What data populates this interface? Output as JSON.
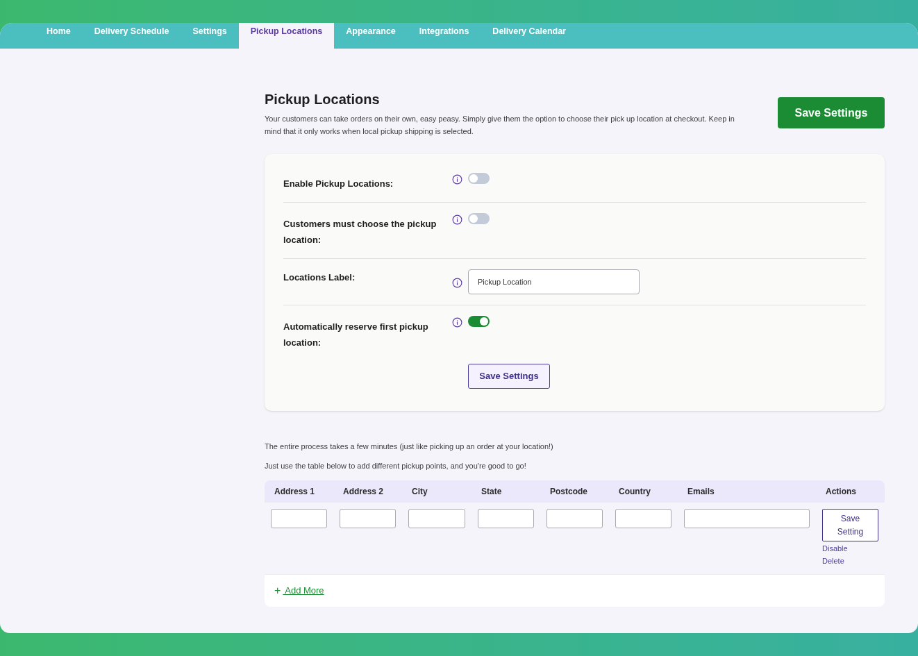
{
  "tabs": [
    {
      "label": "Home",
      "selected": false
    },
    {
      "label": "Delivery Schedule",
      "selected": false
    },
    {
      "label": "Settings",
      "selected": false
    },
    {
      "label": "Pickup Locations",
      "selected": true
    },
    {
      "label": "Appearance",
      "selected": false
    },
    {
      "label": "Integrations",
      "selected": false
    },
    {
      "label": "Delivery Calendar",
      "selected": false
    }
  ],
  "page": {
    "title": "Pickup Locations",
    "description": "Your customers can take orders on their own, easy peasy. Simply give them the option to choose their pick up location at checkout. Keep in mind that it only works when local pickup shipping is selected.",
    "save_button": "Save Settings"
  },
  "settings": [
    {
      "kind": "toggle",
      "label": "Enable Pickup Locations:",
      "on": false
    },
    {
      "kind": "toggle",
      "label": "Customers must choose the pickup location:",
      "on": false
    },
    {
      "kind": "text",
      "label": "Locations Label:",
      "value": "Pickup Location"
    },
    {
      "kind": "toggle",
      "label": "Automatically reserve first pickup location:",
      "on": true
    }
  ],
  "settings_save_button": "Save Settings",
  "notes": [
    "The entire process takes a few minutes (just like picking up an order at your location!)",
    "Just use the table below to add different pickup points, and you're good to go!"
  ],
  "table": {
    "columns": [
      "Address 1",
      "Address 2",
      "City",
      "State",
      "Postcode",
      "Country",
      "Emails",
      "Actions"
    ],
    "row": {
      "save_button": "Save Setting",
      "links": [
        "Disable",
        "Delete"
      ]
    },
    "add_more": {
      "icon": "+",
      "label": " Add More"
    }
  }
}
